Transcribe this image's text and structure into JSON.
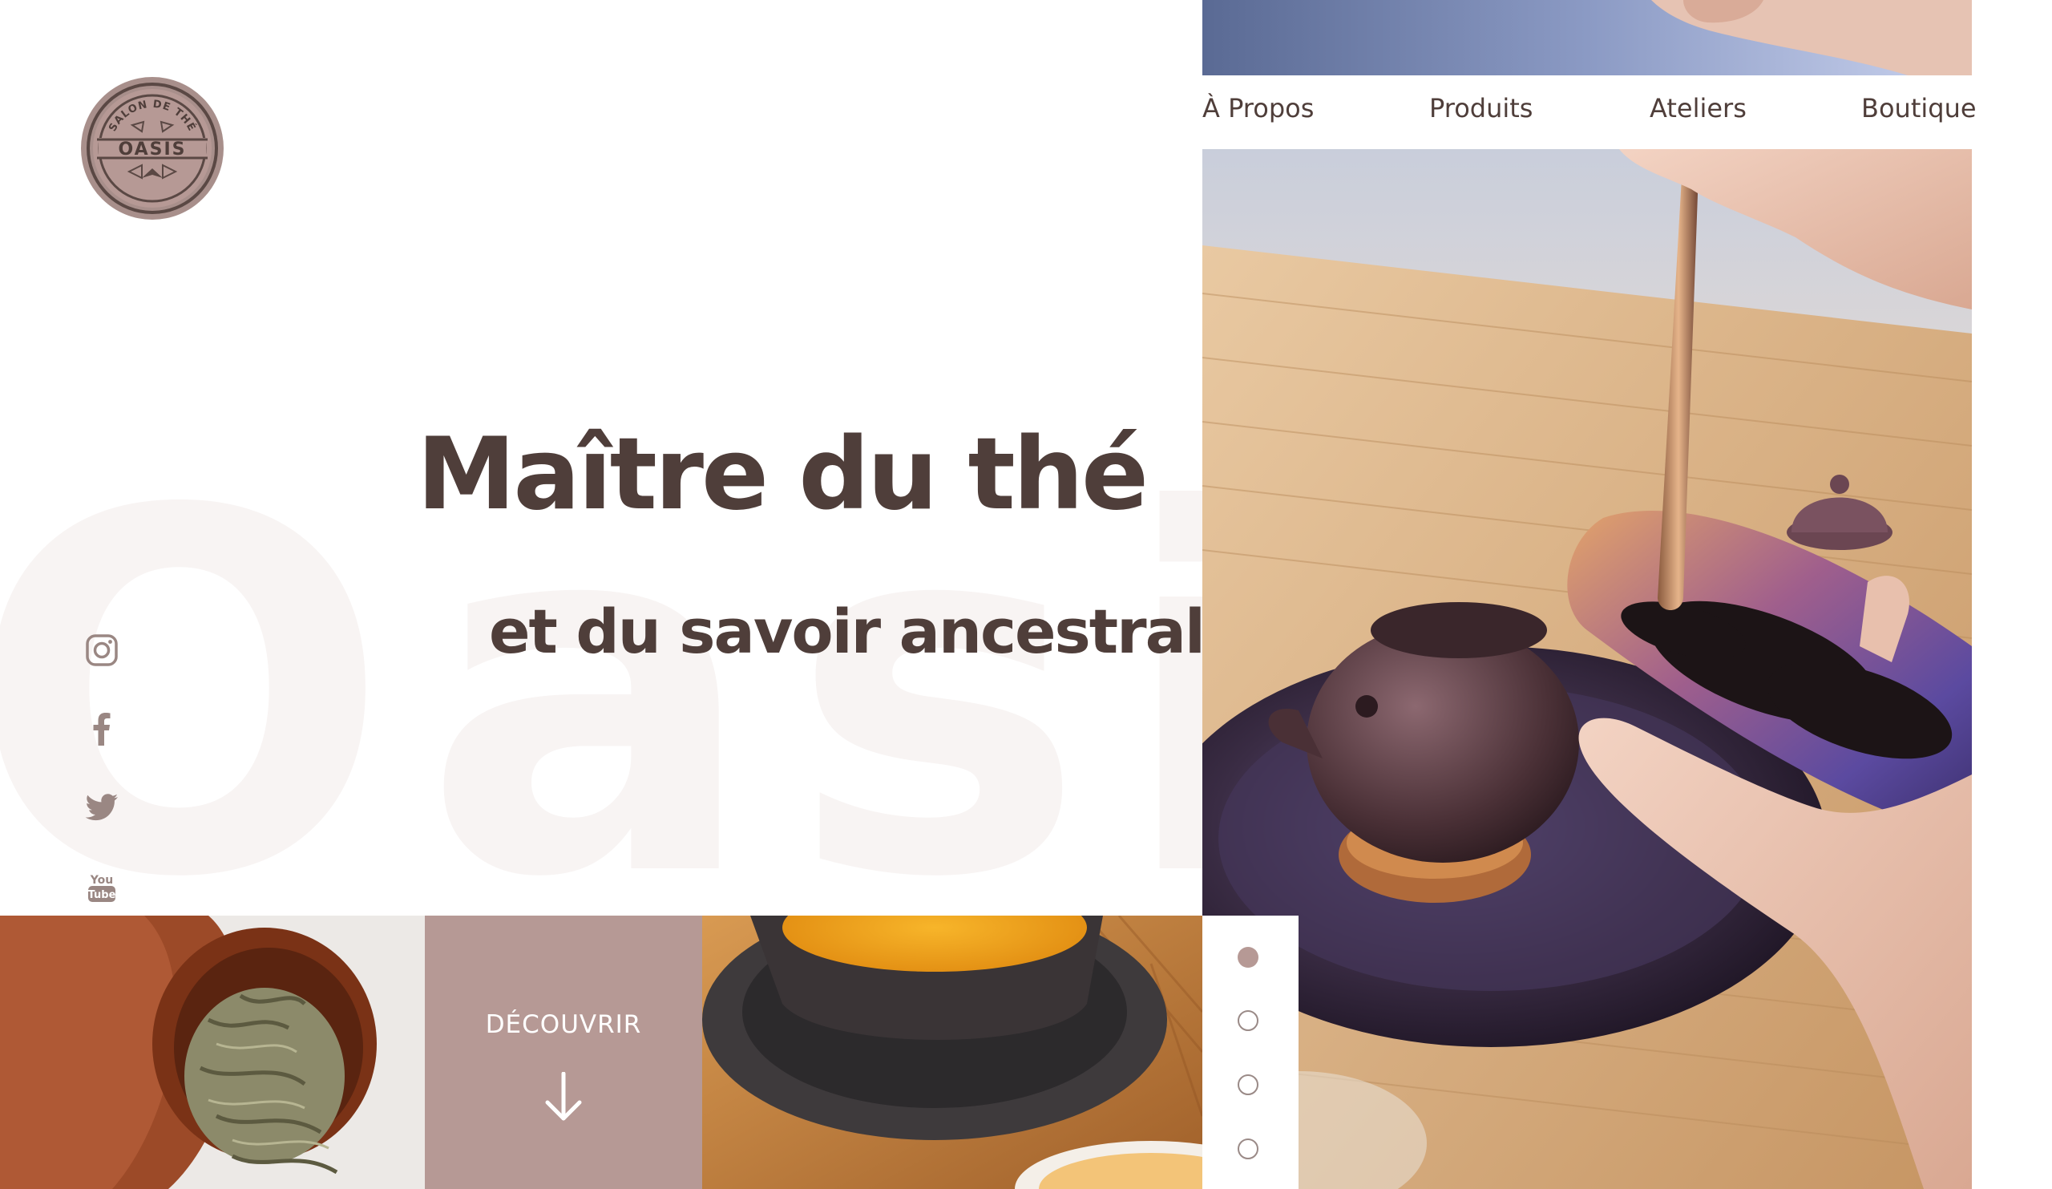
{
  "brand": {
    "logo_arc_text": "SALON DE THÉ",
    "logo_name": "OASIS",
    "watermark": "Oasis"
  },
  "nav": {
    "items": [
      {
        "label": "À Propos"
      },
      {
        "label": "Produits"
      },
      {
        "label": "Ateliers"
      },
      {
        "label": "Boutique"
      }
    ]
  },
  "hero": {
    "title": "Maître du thé",
    "subtitle": "et du savoir ancestral"
  },
  "social": {
    "icons": [
      "instagram-icon",
      "facebook-icon",
      "twitter-icon",
      "youtube-icon"
    ]
  },
  "cta": {
    "label": "DÉCOUVRIR",
    "icon": "arrow-down-icon"
  },
  "slider": {
    "total": 4,
    "active_index": 0
  },
  "colors": {
    "text": "#4f3e3a",
    "accent": "#b69995",
    "dot_border": "#9a8a87",
    "watermark": "#f8f4f3"
  }
}
